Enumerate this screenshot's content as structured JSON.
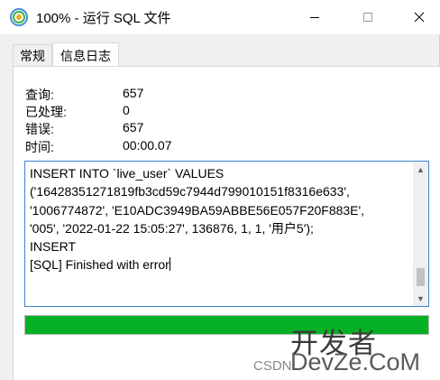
{
  "window": {
    "title": "100% - 运行 SQL 文件"
  },
  "tabs": [
    {
      "label": "常规"
    },
    {
      "label": "信息日志"
    }
  ],
  "stats": [
    {
      "label": "查询:",
      "value": "657"
    },
    {
      "label": "已处理:",
      "value": "0"
    },
    {
      "label": "错误:",
      "value": "657"
    },
    {
      "label": "时间:",
      "value": "00:00.07"
    }
  ],
  "log": {
    "lines": [
      "INSERT INTO `live_user` VALUES",
      "('16428351271819fb3cd59c7944d799010151f8316e633',",
      "'1006774872', 'E10ADC3949BA59ABBE56E057F20F883E',",
      "'005', '2022-01-22 15:05:27', 136876, 1, 1, '用户5');",
      "INSERT",
      "[SQL] Finished with error"
    ]
  },
  "progress": {
    "value": 1.0,
    "color": "#06b025"
  },
  "watermark": {
    "big": "开发者",
    "domain": "DevZe.CoM",
    "source": "CSDN"
  },
  "icons": {
    "app": "navicat-icon",
    "minimize": "minimize-icon",
    "maximize": "maximize-icon",
    "close": "close-icon"
  }
}
